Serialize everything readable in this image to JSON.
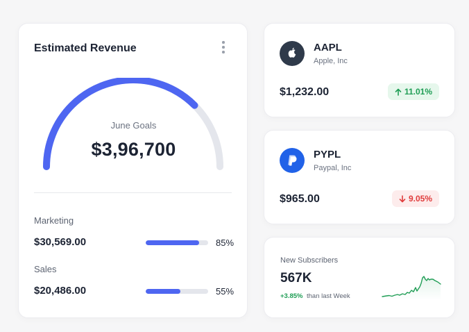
{
  "revenue": {
    "title": "Estimated Revenue",
    "gauge_label": "June Goals",
    "gauge_value": "$3,96,700",
    "gauge_progress": 0.75,
    "metrics": [
      {
        "label": "Marketing",
        "value": "$30,569.00",
        "percent_text": "85%",
        "percent": 85
      },
      {
        "label": "Sales",
        "value": "$20,486.00",
        "percent_text": "55%",
        "percent": 55
      }
    ]
  },
  "stocks": [
    {
      "ticker": "AAPL",
      "company": "Apple, Inc",
      "price": "$1,232.00",
      "change": "11.01%",
      "direction": "up",
      "logo": "apple-logo"
    },
    {
      "ticker": "PYPL",
      "company": "Paypal, Inc",
      "price": "$965.00",
      "change": "9.05%",
      "direction": "down",
      "logo": "paypal-logo"
    }
  ],
  "subscribers": {
    "title": "New Subscribers",
    "value": "567K",
    "change": "+3.85%",
    "period": "than last Week"
  },
  "colors": {
    "accent": "#4e66f1",
    "track": "#e4e6ec",
    "positive": "#1f9d55",
    "negative": "#e03c3c",
    "aapl_logo_bg": "#2f3a4a",
    "pypl_logo_bg": "#2162e8"
  }
}
